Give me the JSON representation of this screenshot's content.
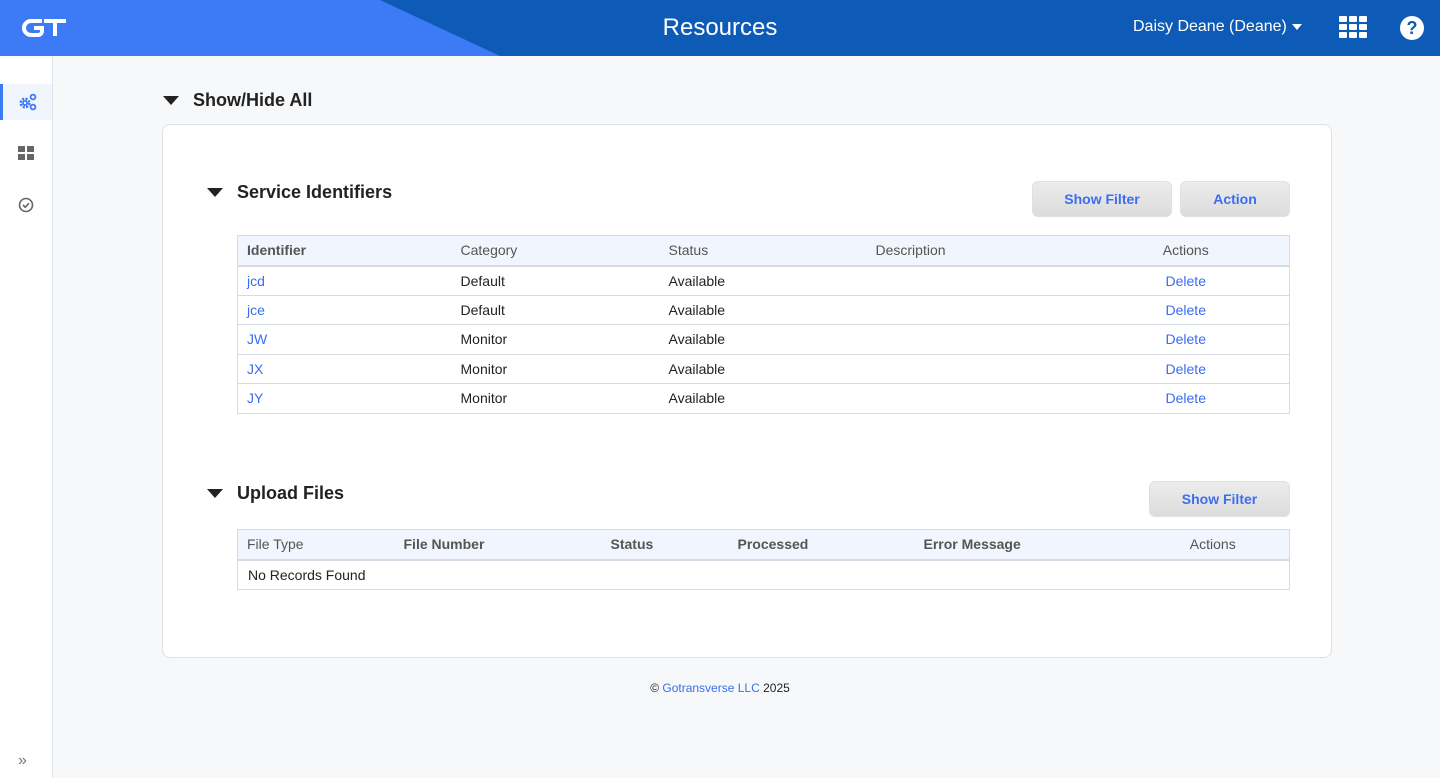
{
  "header": {
    "logo_text": "GT",
    "title": "Resources",
    "user_label": "Daisy Deane (Deane)",
    "apps_icon": "apps-grid-icon",
    "help_icon": "help-circle-icon",
    "colors": {
      "primary": "#0e5bb7",
      "accent": "#3d7af5"
    }
  },
  "sidebar": {
    "items": [
      {
        "name": "resources",
        "icon": "gears-icon",
        "active": true
      },
      {
        "name": "dashboard",
        "icon": "grid-icon",
        "active": false
      },
      {
        "name": "tasks",
        "icon": "check-circle-icon",
        "active": false
      }
    ],
    "expand_icon": "double-chevron-right-icon"
  },
  "main": {
    "show_hide_label": "Show/Hide All",
    "service_identifiers": {
      "title": "Service Identifiers",
      "show_filter_label": "Show Filter",
      "action_label": "Action",
      "columns": [
        "Identifier",
        "Category",
        "Status",
        "Description",
        "Actions"
      ],
      "rows": [
        {
          "identifier": "jcd",
          "category": "Default",
          "status": "Available",
          "description": "",
          "action": "Delete"
        },
        {
          "identifier": "jce",
          "category": "Default",
          "status": "Available",
          "description": "",
          "action": "Delete"
        },
        {
          "identifier": "JW",
          "category": "Monitor",
          "status": "Available",
          "description": "",
          "action": "Delete"
        },
        {
          "identifier": "JX",
          "category": "Monitor",
          "status": "Available",
          "description": "",
          "action": "Delete"
        },
        {
          "identifier": "JY",
          "category": "Monitor",
          "status": "Available",
          "description": "",
          "action": "Delete"
        }
      ]
    },
    "upload_files": {
      "title": "Upload Files",
      "show_filter_label": "Show Filter",
      "columns": [
        "File Type",
        "File Number",
        "Status",
        "Processed",
        "Error Message",
        "Actions"
      ],
      "empty_message": "No Records Found"
    }
  },
  "footer": {
    "copyright": "©",
    "company": "Gotransverse LLC",
    "year": "2025"
  }
}
